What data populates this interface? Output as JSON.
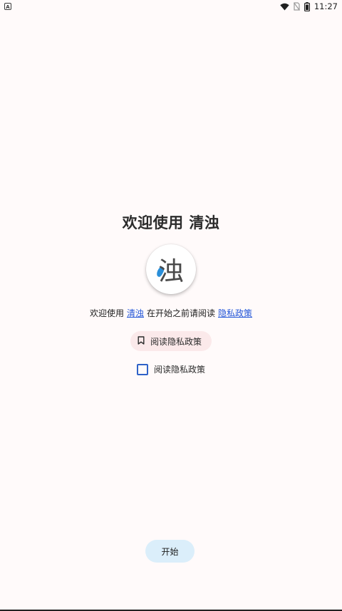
{
  "status_bar": {
    "app_badge": "A",
    "icons": [
      "wifi-icon",
      "no-sim-icon",
      "battery-icon"
    ],
    "time": "11:27"
  },
  "welcome": {
    "title": "欢迎使用 清浊",
    "logo_char": "浊",
    "intro_prefix": "欢迎使用",
    "app_link": "清浊",
    "intro_middle": "在开始之前请阅读",
    "policy_link": "隐私政策"
  },
  "privacy_chip": {
    "label": "阅读隐私政策",
    "icon": "bookmark-icon"
  },
  "agreement_checkbox": {
    "label": "阅读隐私政策",
    "checked": false
  },
  "start_button": {
    "label": "开始"
  },
  "colors": {
    "background": "#fffafa",
    "link": "#2356d8",
    "chip_bg": "#fbe9ea",
    "button_bg": "#dbeefa",
    "checkbox_border": "#2f62c8"
  }
}
